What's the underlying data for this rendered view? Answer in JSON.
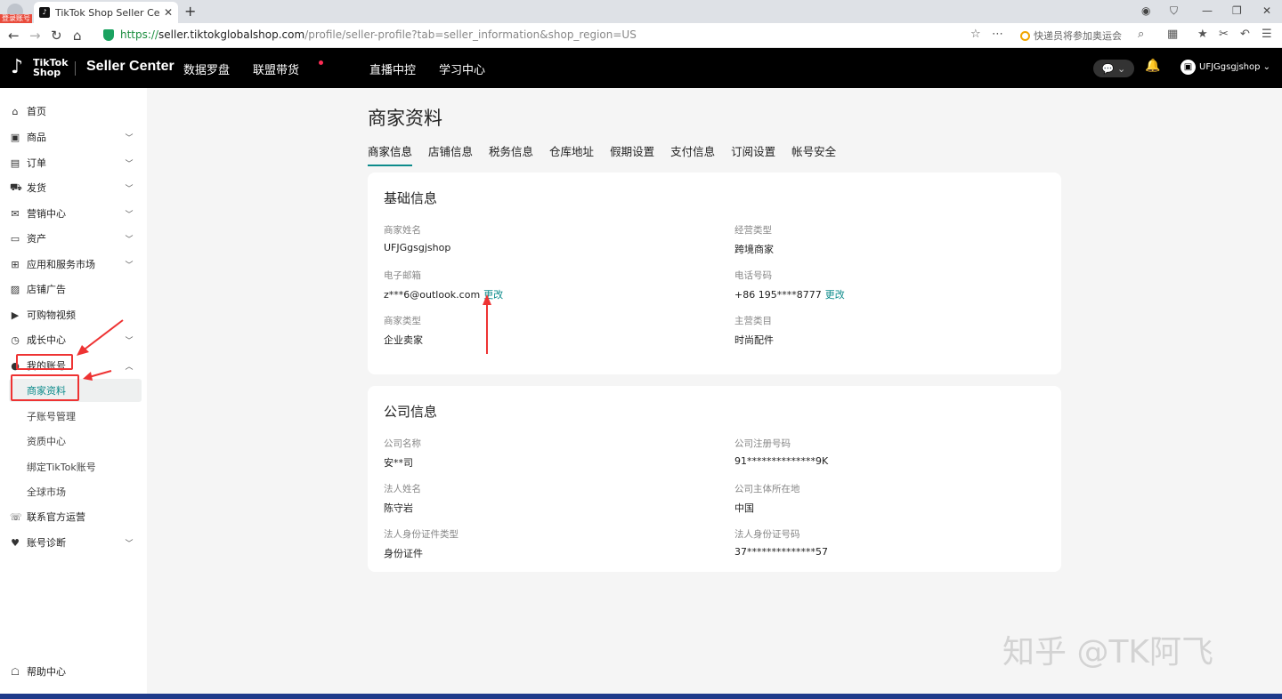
{
  "browser": {
    "badge_label": "登录账号",
    "tab_title": "TikTok Shop Seller Center |",
    "url_scheme": "https://",
    "url_host": "seller.tiktokglobalshop.com",
    "url_path": "/profile/seller-profile?tab=seller_information&shop_region=US",
    "search_text": "快递员将参加奥运会"
  },
  "header": {
    "logo_text_top": "TikTok",
    "logo_text_bottom": "Shop",
    "product_name": "Seller Center",
    "nav": [
      "数据罗盘",
      "联盟带货",
      "直播中控",
      "学习中心"
    ],
    "account_name": "UFJGgsgjshop"
  },
  "sidebar": {
    "items": [
      {
        "label": "首页",
        "icon": "⌂",
        "chevron": false
      },
      {
        "label": "商品",
        "icon": "▣",
        "chevron": true
      },
      {
        "label": "订单",
        "icon": "▤",
        "chevron": true
      },
      {
        "label": "发货",
        "icon": "⛟",
        "chevron": true
      },
      {
        "label": "营销中心",
        "icon": "✉",
        "chevron": true
      },
      {
        "label": "资产",
        "icon": "▭",
        "chevron": true
      },
      {
        "label": "应用和服务市场",
        "icon": "⊞",
        "chevron": true
      },
      {
        "label": "店铺广告",
        "icon": "▨",
        "chevron": false
      },
      {
        "label": "可购物视频",
        "icon": "▶",
        "chevron": false
      },
      {
        "label": "成长中心",
        "icon": "◷",
        "chevron": true
      },
      {
        "label": "我的账号",
        "icon": "●",
        "chevron": true
      }
    ],
    "sub_items": [
      "商家资料",
      "子账号管理",
      "资质中心",
      "绑定TikTok账号",
      "全球市场"
    ],
    "bottom_items": [
      {
        "label": "联系官方运营",
        "icon": "☏",
        "chevron": false
      },
      {
        "label": "账号诊断",
        "icon": "♥",
        "chevron": true
      }
    ],
    "help": "帮助中心"
  },
  "main": {
    "title": "商家资料",
    "tabs": [
      "商家信息",
      "店铺信息",
      "税务信息",
      "仓库地址",
      "假期设置",
      "支付信息",
      "订阅设置",
      "帐号安全"
    ],
    "basic": {
      "title": "基础信息",
      "fields": [
        {
          "key": "商家姓名",
          "value": "UFJGgsgjshop",
          "link": ""
        },
        {
          "key": "经营类型",
          "value": "跨境商家",
          "link": ""
        },
        {
          "key": "电子邮箱",
          "value": "z***6@outlook.com",
          "link": "更改"
        },
        {
          "key": "电话号码",
          "value": "+86 195****8777",
          "link": "更改"
        },
        {
          "key": "商家类型",
          "value": "企业卖家",
          "link": ""
        },
        {
          "key": "主营类目",
          "value": "时尚配件",
          "link": ""
        }
      ]
    },
    "company": {
      "title": "公司信息",
      "fields": [
        {
          "key": "公司名称",
          "value": "安**司"
        },
        {
          "key": "公司注册号码",
          "value": "91**************9K"
        },
        {
          "key": "法人姓名",
          "value": "陈守岩"
        },
        {
          "key": "公司主体所在地",
          "value": "中国"
        },
        {
          "key": "法人身份证件类型",
          "value": "身份证件"
        },
        {
          "key": "法人身份证号码",
          "value": "37**************57"
        }
      ]
    }
  },
  "watermark": "知乎 @TK阿飞",
  "colors": {
    "accent": "#0d8b8b",
    "annotation": "#e33333",
    "header_bg": "#000000"
  }
}
